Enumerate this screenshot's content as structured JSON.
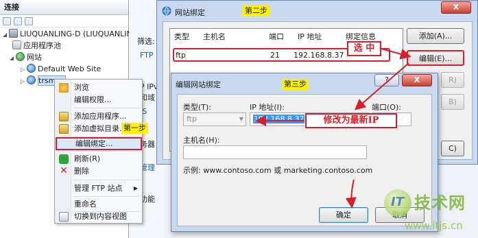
{
  "connections": {
    "header": "连接",
    "tree": {
      "server": "LIUQUANLING-D (LIUQUANLIN",
      "app_pool": "应用程序池",
      "sites": "网站",
      "default_site": "Default Web Site",
      "current_site": "trsmgr"
    }
  },
  "middle": {
    "filter_label": "筛选:",
    "ftp_group": "FTP",
    "ip_label": "P IPv",
    "auth_label": "和域",
    "iis_group": "IS",
    "server_label": "务器",
    "mgmt_group": "管理",
    "func_label": "功能"
  },
  "context_menu": {
    "items": [
      {
        "label": "浏览",
        "icon": "browse-icon"
      },
      {
        "label": "编辑权限...",
        "icon": ""
      },
      {
        "label": "添加应用程序...",
        "icon": "add-application-icon"
      },
      {
        "label": "添加虚拟目录...",
        "icon": "add-virtual-directory-icon"
      },
      {
        "label": "编辑绑定...",
        "icon": ""
      },
      {
        "label": "刷新(R)",
        "icon": "refresh-icon"
      },
      {
        "label": "删除",
        "icon": "delete-icon"
      },
      {
        "label": "管理 FTP 站点",
        "icon": ""
      },
      {
        "label": "重命名",
        "icon": ""
      },
      {
        "label": "切换到内容视图",
        "icon": "content-view-icon"
      }
    ]
  },
  "bindings_dialog": {
    "title": "网站绑定",
    "close_label": "X",
    "columns": [
      "类型",
      "主机名",
      "端口",
      "IP 地址",
      "绑定信息"
    ],
    "rows": [
      {
        "type": "ftp",
        "host": "",
        "port": "21",
        "ip": "192.168.8.37",
        "info": ""
      }
    ],
    "buttons": {
      "add": "添加(A)...",
      "edit": "编辑(E)...",
      "remove": "R)",
      "browse": "B)",
      "close": "C)"
    }
  },
  "edit_dialog": {
    "title": "编辑网站绑定",
    "help_label": "?",
    "close_label": "X",
    "type_label": "类型(T):",
    "type_value": "ftp",
    "ip_label": "IP 地址(I):",
    "ip_value": "192.168.8.37",
    "port_label": "端口(O):",
    "port_value": "",
    "host_label": "主机名(H):",
    "host_value": "",
    "example": "示例: www.contoso.com 或 marketing.contoso.com",
    "ok_label": "确定",
    "cancel_label": "取消"
  },
  "annotations": {
    "step1": "第一步",
    "step2": "第二步",
    "step3": "第三步",
    "select": "选 中",
    "modify": "修改为最新IP"
  },
  "watermark": {
    "logo_text": "IT",
    "name": "技术网",
    "url": "www.itjs.cn"
  },
  "colors": {
    "annotation_red": "#d81e2c",
    "annotation_yellow": "#fff200",
    "selection_blue": "#3399ff"
  }
}
